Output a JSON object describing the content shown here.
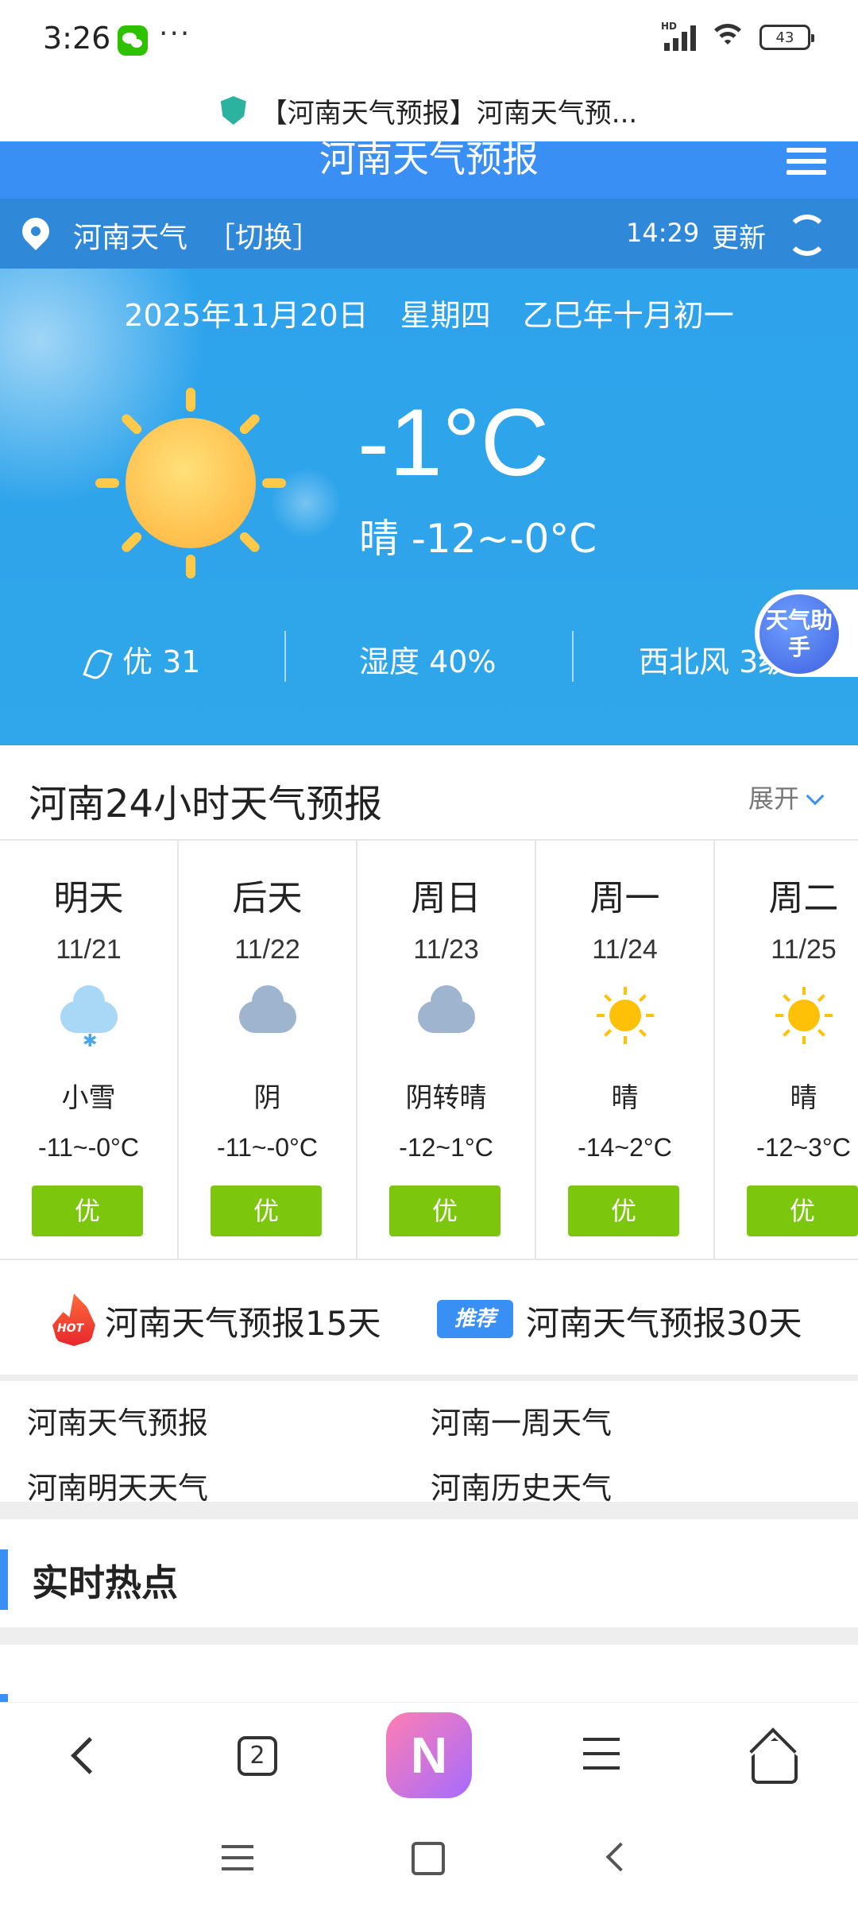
{
  "status_bar": {
    "time": "3:26",
    "more": "···",
    "signal": "HD",
    "battery": "43"
  },
  "browser": {
    "page_title": "【河南天气预报】河南天气预..."
  },
  "site": {
    "name": "河南天气预报"
  },
  "location": {
    "city": "河南天气",
    "switch_label": "［切换］",
    "update_time": "14:29",
    "refresh_label": "更新"
  },
  "hero": {
    "date": "2025年11月20日",
    "weekday": "星期四",
    "lunar": "乙巳年十月初一",
    "temp_now": "-1°C",
    "today_range": "晴 -12~-0°C",
    "aqi": "优 31",
    "humidity": "湿度 40%",
    "wind": "西北风 3级",
    "assistant": "天气助手"
  },
  "forecast": {
    "title": "河南24小时天气预报",
    "expand_label": "展开",
    "days": [
      {
        "name": "明天",
        "date": "11/21",
        "icon": "snow-icon",
        "cond": "小雪",
        "range": "-11~-0°C",
        "aqi": "优"
      },
      {
        "name": "后天",
        "date": "11/22",
        "icon": "cloud-icon",
        "cond": "阴",
        "range": "-11~-0°C",
        "aqi": "优"
      },
      {
        "name": "周日",
        "date": "11/23",
        "icon": "cloud-icon",
        "cond": "阴转晴",
        "range": "-12~1°C",
        "aqi": "优"
      },
      {
        "name": "周一",
        "date": "11/24",
        "icon": "sun-icon",
        "cond": "晴",
        "range": "-14~2°C",
        "aqi": "优"
      },
      {
        "name": "周二",
        "date": "11/25",
        "icon": "sun-icon",
        "cond": "晴",
        "range": "-12~3°C",
        "aqi": "优"
      }
    ]
  },
  "long_range": {
    "hot_badge": "HOT",
    "link15": "河南天气预报15天",
    "rec_badge": "推荐",
    "link30": "河南天气预报30天"
  },
  "quick_links": [
    "河南天气预报",
    "河南一周天气",
    "河南明天天气",
    "河南历史天气"
  ],
  "hotspot": {
    "title": "实时热点"
  },
  "toolbar": {
    "tabs_count": "2",
    "ai_label": "N"
  },
  "colors": {
    "header": "#3a8ff5",
    "location_bar": "#3088d8",
    "hero": "#2ea3ec",
    "aqi_good": "#7cc70e"
  }
}
